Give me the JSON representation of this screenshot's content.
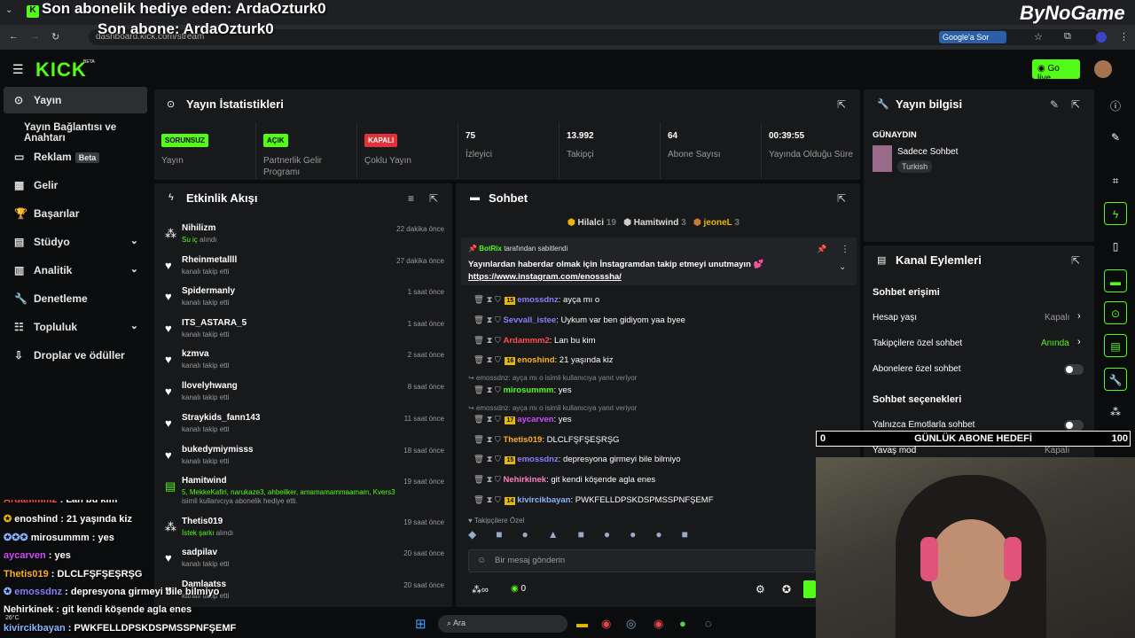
{
  "overlay": {
    "line1": "Son abonelik hediye eden: ArdaOzturk0",
    "line2": "Son abone: ArdaOzturk0",
    "brand": "ByNoGame",
    "google_sor": "Google'a Sor",
    "url": "dashboard.kick.com/stream"
  },
  "header": {
    "logo": "KICK",
    "go_live": "Go live"
  },
  "sidebar": {
    "items": [
      {
        "label": "Yayın"
      },
      {
        "label": "Yayın Bağlantısı ve Anahtarı"
      },
      {
        "label": "Reklam",
        "badge": "Beta"
      },
      {
        "label": "Gelir"
      },
      {
        "label": "Başarılar"
      },
      {
        "label": "Stüdyo"
      },
      {
        "label": "Analitik"
      },
      {
        "label": "Denetleme"
      },
      {
        "label": "Topluluk"
      },
      {
        "label": "Droplar ve ödüller"
      }
    ]
  },
  "stats": {
    "title": "Yayın İstatistikleri",
    "items": [
      {
        "badge": "SORUNSUZ",
        "label": "Yayın",
        "color": "#53fc18"
      },
      {
        "badge": "AÇIK",
        "label": "Partnerlik Gelir Programı",
        "color": "#53fc18"
      },
      {
        "badge": "KAPALI",
        "label": "Çoklu Yayın",
        "color": "#e0323a"
      },
      {
        "value": "75",
        "label": "İzleyici"
      },
      {
        "value": "13.992",
        "label": "Takipçi"
      },
      {
        "value": "64",
        "label": "Abone Sayısı"
      },
      {
        "value": "00:39:55",
        "label": "Yayında Olduğu Süre"
      }
    ]
  },
  "activity": {
    "title": "Etkinlik Akışı",
    "items": [
      {
        "name": "Nihilizm",
        "sub_hl": "Su iç",
        "sub": " alındı",
        "time": "22 dakika önce"
      },
      {
        "name": "Rheinmetallll",
        "sub": "kanalı takip etti",
        "time": "27 dakika önce"
      },
      {
        "name": "Spidermanly",
        "sub": "kanalı takip etti",
        "time": "1 saat önce"
      },
      {
        "name": "ITS_ASTARA_5",
        "sub": "kanalı takip etti",
        "time": "1 saat önce"
      },
      {
        "name": "kzmva",
        "sub": "kanalı takip etti",
        "time": "2 saat önce"
      },
      {
        "name": "llovelyhwang",
        "sub": "kanalı takip etti",
        "time": "8 saat önce"
      },
      {
        "name": "Straykids_fann143",
        "sub": "kanalı takip etti",
        "time": "11 saat önce"
      },
      {
        "name": "bukedymiymisss",
        "sub": "kanalı takip etti",
        "time": "18 saat önce"
      },
      {
        "name": "Hamitwind",
        "sub_hl": "5, MekkeKafiri, narukaze3, ahbeilker, amamamammaamam, Kvers3",
        "sub": " isimli kullanıcıya abonelik hediye etti.",
        "time": "19 saat önce"
      },
      {
        "name": "Thetis019",
        "sub_hl": "İstek şarkı",
        "sub": " alındı",
        "time": "19 saat önce"
      },
      {
        "name": "sadpilav",
        "sub": "kanalı takip etti",
        "time": "20 saat önce"
      },
      {
        "name": "Damlaatss",
        "sub": "kanalı takip etti",
        "time": "20 saat önce"
      }
    ]
  },
  "chat": {
    "title": "Sohbet",
    "top_gifters": [
      {
        "name": "Hilalci",
        "n": "19"
      },
      {
        "name": "Hamitwind",
        "n": "3"
      },
      {
        "name": "jeoneL",
        "n": "3"
      }
    ],
    "pinned": {
      "by": "BotRix",
      "by_suffix": "tarafından sabitlendi",
      "text": "Yayınlardan haberdar olmak için İnstagramdan takip etmeyi unutmayın 💕",
      "link": "https://www.instagram.com/enosssha/"
    },
    "messages": [
      {
        "lvl": "15",
        "user": "emossdnz",
        "color": "#8f7dff",
        "text": "ayça mı o"
      },
      {
        "lvl": "",
        "user": "Sevvall_istee",
        "color": "#8f7dff",
        "text": "Uykum var ben gidiyom yaa byee"
      },
      {
        "lvl": "",
        "user": "Ardammm2",
        "color": "#ff4d4d",
        "text": "Lan bu kim"
      },
      {
        "lvl": "16",
        "user": "enoshind",
        "color": "#ffb020",
        "text": "21 yaşında kiz",
        "reply": "emossdnz: ayça mı o isimli kullanıcıya yanıt veriyor"
      },
      {
        "lvl": "",
        "user": "mirosummm",
        "color": "#53fc18",
        "text": "yes",
        "reply": "emossdnz: ayça mı o isimli kullanıcıya yanıt veriyor"
      },
      {
        "lvl": "17",
        "user": "aycarven",
        "color": "#d04dff",
        "text": "yes"
      },
      {
        "lvl": "",
        "user": "Thetis019",
        "color": "#ffb020",
        "text": "DLCLFŞFŞEŞRŞG"
      },
      {
        "lvl": "15",
        "user": "emossdnz",
        "color": "#8f7dff",
        "text": "depresyona girmeyi bile bilmiyo"
      },
      {
        "lvl": "",
        "user": "Nehirkinek",
        "color": "#ff80c0",
        "text": "git kendi köşende agla enes"
      },
      {
        "lvl": "14",
        "user": "kivircikbayan",
        "color": "#8ab4ff",
        "text": "PWKFELLDPSKDSPMSSPNFŞEMF"
      }
    ],
    "followers_only": "Takipçilere Özel",
    "input_placeholder": "Bir mesaj gönderin",
    "points": "0"
  },
  "info": {
    "title": "Yayın bilgisi",
    "greeting": "GÜNAYDIN",
    "category": "Sadece Sohbet",
    "language": "Turkish"
  },
  "channel": {
    "title": "Kanal Eylemleri",
    "access": "Sohbet erişimi",
    "rows": [
      {
        "label": "Hesap yaşı",
        "value": "Kapalı"
      },
      {
        "label": "Takipçilere özel sohbet",
        "value": "Anında"
      },
      {
        "label": "Abonelere özel sohbet",
        "value": ""
      }
    ],
    "options": "Sohbet seçenekleri",
    "emote_only": "Yalnızca Emotlarla sohbet",
    "slow": "Yavaş mod",
    "slow_value": "Kapalı"
  },
  "goal": {
    "left": "0",
    "title": "GÜNLÜK ABONE HEDEFİ",
    "right": "100"
  },
  "stream_chat": [
    {
      "user": "Ardammm2",
      "text": "Lan bu kim",
      "color": "#ff4d4d"
    },
    {
      "user": "enoshind",
      "text": "21 yaşında kiz",
      "color": "#ffffff"
    },
    {
      "user": "mirosummm",
      "text": "yes",
      "color": "#ffffff"
    },
    {
      "user": "aycarven",
      "text": "yes",
      "color": "#d04dff"
    },
    {
      "user": "Thetis019",
      "text": "DLCLFŞFŞEŞRŞG",
      "color": "#ffb020"
    },
    {
      "user": "emossdnz",
      "text": "depresyona girmeyi bile bilmiyo",
      "color": "#8f7dff"
    },
    {
      "user": "Nehirkinek",
      "text": "git kendi köşende agla enes",
      "color": "#ffffff"
    },
    {
      "user": "kivircikbayan",
      "text": "PWKFELLDPSKDSPMSSPNFŞEMF",
      "color": "#8ab4ff"
    }
  ],
  "taskbar": {
    "search": "Ara",
    "weather": "26°C"
  }
}
